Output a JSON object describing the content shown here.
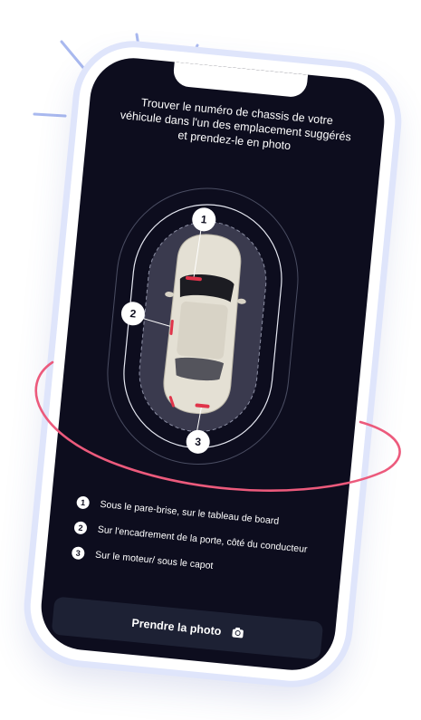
{
  "instructions": {
    "line1": "Trouver le numéro de chassis de votre",
    "line2": "véhicule dans l'un des emplacement suggérés",
    "line3": "et prendez-le en photo"
  },
  "markers": [
    "1",
    "2",
    "3"
  ],
  "legend": [
    {
      "num": "1",
      "text": "Sous le pare-brise, sur le tableau de board"
    },
    {
      "num": "2",
      "text": "Sur l'encadrement de la porte, côté du conducteur"
    },
    {
      "num": "3",
      "text": "Sur le moteur/ sous le capot"
    }
  ],
  "cta": {
    "label": "Prendre la photo",
    "icon": "camera-icon"
  },
  "colors": {
    "screen_bg": "#0d0d1e",
    "accent_red": "#e0344a",
    "swoosh": "#ec5a7c",
    "phone_frame": "#dfe5fb",
    "button_bg": "#1d2134"
  }
}
